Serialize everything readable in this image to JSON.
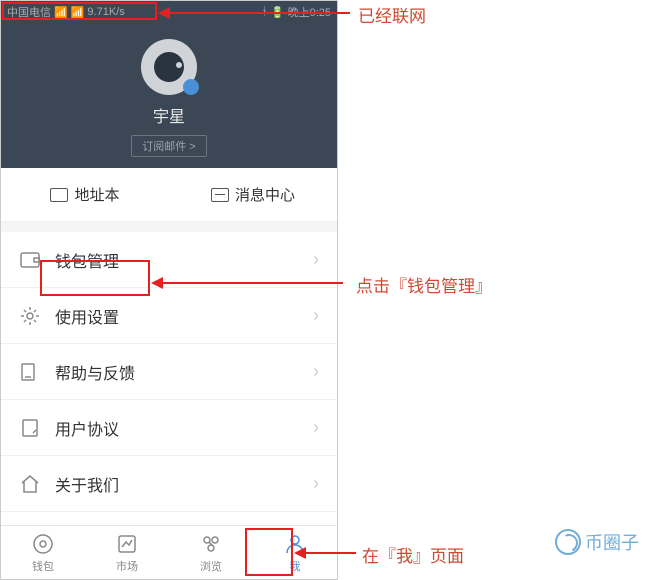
{
  "status": {
    "carrier": "中国电信",
    "speed": "9.71K/s",
    "time": "晚上9:25"
  },
  "profile": {
    "username": "宇星",
    "subscribe": "订阅邮件 >"
  },
  "quick": {
    "addressbook": "地址本",
    "messages": "消息中心"
  },
  "menu": {
    "wallet": "钱包管理",
    "settings": "使用设置",
    "help": "帮助与反馈",
    "agreement": "用户协议",
    "about": "关于我们"
  },
  "tabs": {
    "wallet": "钱包",
    "market": "市场",
    "browse": "浏览",
    "me": "我"
  },
  "annotations": {
    "network": "已经联网",
    "wallet_mgmt": "点击『钱包管理』",
    "me_page": "在『我』页面"
  },
  "watermark": "币圈子"
}
